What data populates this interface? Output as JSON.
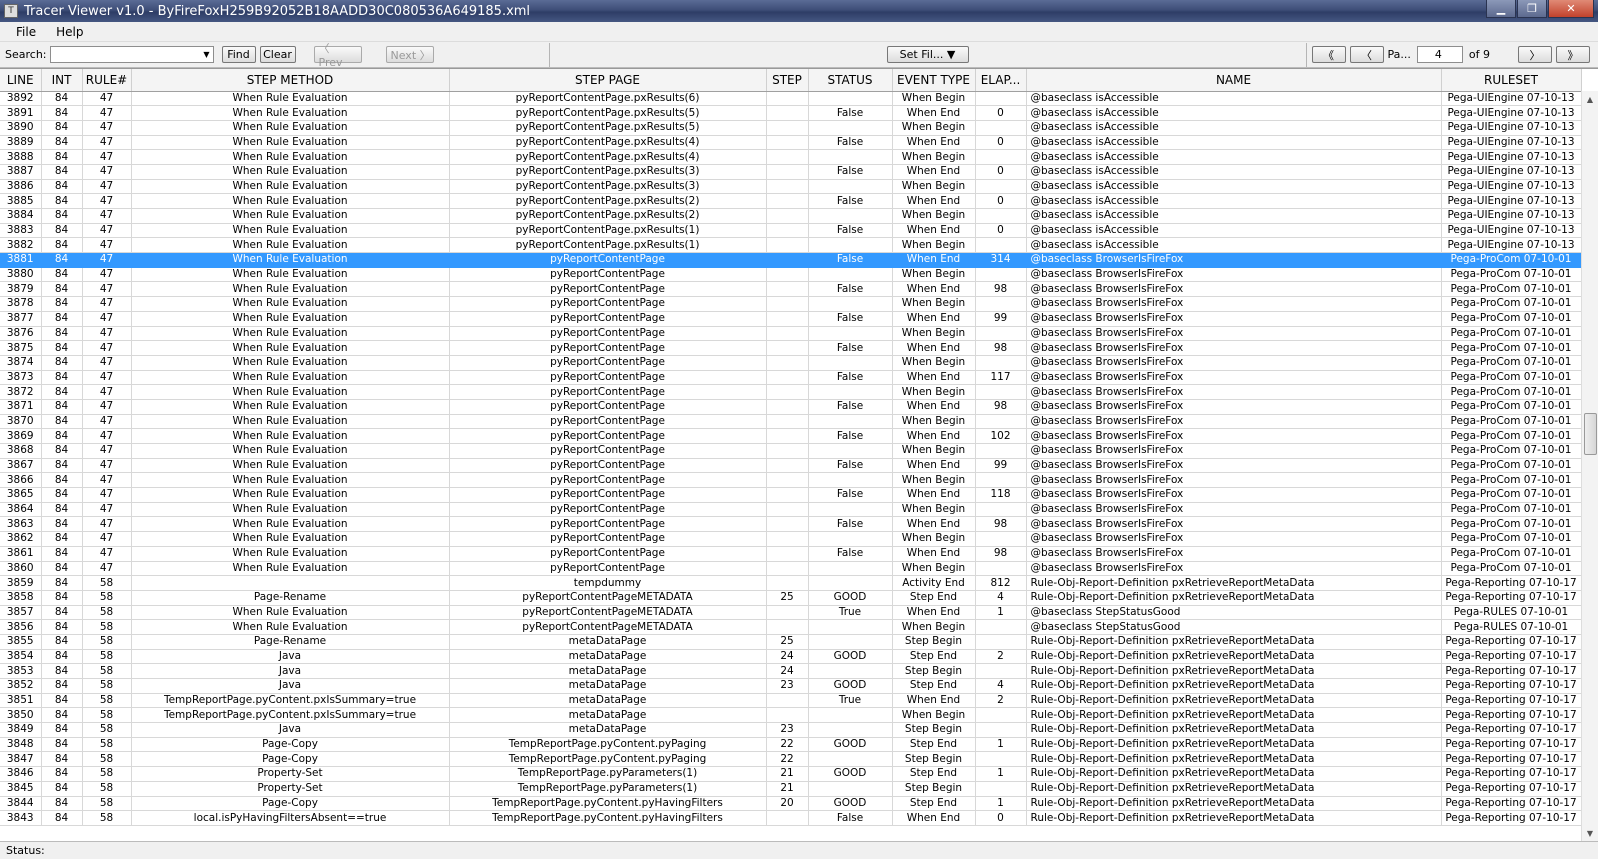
{
  "window": {
    "title": "Tracer Viewer v1.0 - ByFireFoxH259B92052B18AADD30C080536A649185.xml",
    "app_icon": "tracer-app-icon"
  },
  "menu": {
    "file": "File",
    "help": "Help"
  },
  "toolbar": {
    "search_label": "Search:",
    "search_value": "",
    "find": "Find",
    "clear": "Clear",
    "prev": "〈 Prev",
    "next": "Next 〉",
    "set_filter": "Set Fil... ▼",
    "first_page": "《",
    "prev_page": "〈",
    "page_label": "Pa...",
    "page_value": "4",
    "page_total": "of 9",
    "next_page": "〉",
    "last_page": "》"
  },
  "columns": [
    "LINE",
    "INT",
    "RULE#",
    "STEP METHOD",
    "STEP PAGE",
    "STEP",
    "STATUS",
    "EVENT TYPE",
    "ELAP...",
    "NAME",
    "RULESET"
  ],
  "selected_line": "3881",
  "rows": [
    [
      "3892",
      "84",
      "47",
      "When Rule Evaluation",
      "pyReportContentPage.pxResults(6)",
      "",
      "",
      "When Begin",
      "",
      "@baseclass isAccessible",
      "Pega-UIEngine 07-10-13"
    ],
    [
      "3891",
      "84",
      "47",
      "When Rule Evaluation",
      "pyReportContentPage.pxResults(5)",
      "",
      "False",
      "When End",
      "0",
      "@baseclass isAccessible",
      "Pega-UIEngine 07-10-13"
    ],
    [
      "3890",
      "84",
      "47",
      "When Rule Evaluation",
      "pyReportContentPage.pxResults(5)",
      "",
      "",
      "When Begin",
      "",
      "@baseclass isAccessible",
      "Pega-UIEngine 07-10-13"
    ],
    [
      "3889",
      "84",
      "47",
      "When Rule Evaluation",
      "pyReportContentPage.pxResults(4)",
      "",
      "False",
      "When End",
      "0",
      "@baseclass isAccessible",
      "Pega-UIEngine 07-10-13"
    ],
    [
      "3888",
      "84",
      "47",
      "When Rule Evaluation",
      "pyReportContentPage.pxResults(4)",
      "",
      "",
      "When Begin",
      "",
      "@baseclass isAccessible",
      "Pega-UIEngine 07-10-13"
    ],
    [
      "3887",
      "84",
      "47",
      "When Rule Evaluation",
      "pyReportContentPage.pxResults(3)",
      "",
      "False",
      "When End",
      "0",
      "@baseclass isAccessible",
      "Pega-UIEngine 07-10-13"
    ],
    [
      "3886",
      "84",
      "47",
      "When Rule Evaluation",
      "pyReportContentPage.pxResults(3)",
      "",
      "",
      "When Begin",
      "",
      "@baseclass isAccessible",
      "Pega-UIEngine 07-10-13"
    ],
    [
      "3885",
      "84",
      "47",
      "When Rule Evaluation",
      "pyReportContentPage.pxResults(2)",
      "",
      "False",
      "When End",
      "0",
      "@baseclass isAccessible",
      "Pega-UIEngine 07-10-13"
    ],
    [
      "3884",
      "84",
      "47",
      "When Rule Evaluation",
      "pyReportContentPage.pxResults(2)",
      "",
      "",
      "When Begin",
      "",
      "@baseclass isAccessible",
      "Pega-UIEngine 07-10-13"
    ],
    [
      "3883",
      "84",
      "47",
      "When Rule Evaluation",
      "pyReportContentPage.pxResults(1)",
      "",
      "False",
      "When End",
      "0",
      "@baseclass isAccessible",
      "Pega-UIEngine 07-10-13"
    ],
    [
      "3882",
      "84",
      "47",
      "When Rule Evaluation",
      "pyReportContentPage.pxResults(1)",
      "",
      "",
      "When Begin",
      "",
      "@baseclass isAccessible",
      "Pega-UIEngine 07-10-13"
    ],
    [
      "3881",
      "84",
      "47",
      "When Rule Evaluation",
      "pyReportContentPage",
      "",
      "False",
      "When End",
      "314",
      "@baseclass BrowserIsFireFox",
      "Pega-ProCom 07-10-01"
    ],
    [
      "3880",
      "84",
      "47",
      "When Rule Evaluation",
      "pyReportContentPage",
      "",
      "",
      "When Begin",
      "",
      "@baseclass BrowserIsFireFox",
      "Pega-ProCom 07-10-01"
    ],
    [
      "3879",
      "84",
      "47",
      "When Rule Evaluation",
      "pyReportContentPage",
      "",
      "False",
      "When End",
      "98",
      "@baseclass BrowserIsFireFox",
      "Pega-ProCom 07-10-01"
    ],
    [
      "3878",
      "84",
      "47",
      "When Rule Evaluation",
      "pyReportContentPage",
      "",
      "",
      "When Begin",
      "",
      "@baseclass BrowserIsFireFox",
      "Pega-ProCom 07-10-01"
    ],
    [
      "3877",
      "84",
      "47",
      "When Rule Evaluation",
      "pyReportContentPage",
      "",
      "False",
      "When End",
      "99",
      "@baseclass BrowserIsFireFox",
      "Pega-ProCom 07-10-01"
    ],
    [
      "3876",
      "84",
      "47",
      "When Rule Evaluation",
      "pyReportContentPage",
      "",
      "",
      "When Begin",
      "",
      "@baseclass BrowserIsFireFox",
      "Pega-ProCom 07-10-01"
    ],
    [
      "3875",
      "84",
      "47",
      "When Rule Evaluation",
      "pyReportContentPage",
      "",
      "False",
      "When End",
      "98",
      "@baseclass BrowserIsFireFox",
      "Pega-ProCom 07-10-01"
    ],
    [
      "3874",
      "84",
      "47",
      "When Rule Evaluation",
      "pyReportContentPage",
      "",
      "",
      "When Begin",
      "",
      "@baseclass BrowserIsFireFox",
      "Pega-ProCom 07-10-01"
    ],
    [
      "3873",
      "84",
      "47",
      "When Rule Evaluation",
      "pyReportContentPage",
      "",
      "False",
      "When End",
      "117",
      "@baseclass BrowserIsFireFox",
      "Pega-ProCom 07-10-01"
    ],
    [
      "3872",
      "84",
      "47",
      "When Rule Evaluation",
      "pyReportContentPage",
      "",
      "",
      "When Begin",
      "",
      "@baseclass BrowserIsFireFox",
      "Pega-ProCom 07-10-01"
    ],
    [
      "3871",
      "84",
      "47",
      "When Rule Evaluation",
      "pyReportContentPage",
      "",
      "False",
      "When End",
      "98",
      "@baseclass BrowserIsFireFox",
      "Pega-ProCom 07-10-01"
    ],
    [
      "3870",
      "84",
      "47",
      "When Rule Evaluation",
      "pyReportContentPage",
      "",
      "",
      "When Begin",
      "",
      "@baseclass BrowserIsFireFox",
      "Pega-ProCom 07-10-01"
    ],
    [
      "3869",
      "84",
      "47",
      "When Rule Evaluation",
      "pyReportContentPage",
      "",
      "False",
      "When End",
      "102",
      "@baseclass BrowserIsFireFox",
      "Pega-ProCom 07-10-01"
    ],
    [
      "3868",
      "84",
      "47",
      "When Rule Evaluation",
      "pyReportContentPage",
      "",
      "",
      "When Begin",
      "",
      "@baseclass BrowserIsFireFox",
      "Pega-ProCom 07-10-01"
    ],
    [
      "3867",
      "84",
      "47",
      "When Rule Evaluation",
      "pyReportContentPage",
      "",
      "False",
      "When End",
      "99",
      "@baseclass BrowserIsFireFox",
      "Pega-ProCom 07-10-01"
    ],
    [
      "3866",
      "84",
      "47",
      "When Rule Evaluation",
      "pyReportContentPage",
      "",
      "",
      "When Begin",
      "",
      "@baseclass BrowserIsFireFox",
      "Pega-ProCom 07-10-01"
    ],
    [
      "3865",
      "84",
      "47",
      "When Rule Evaluation",
      "pyReportContentPage",
      "",
      "False",
      "When End",
      "118",
      "@baseclass BrowserIsFireFox",
      "Pega-ProCom 07-10-01"
    ],
    [
      "3864",
      "84",
      "47",
      "When Rule Evaluation",
      "pyReportContentPage",
      "",
      "",
      "When Begin",
      "",
      "@baseclass BrowserIsFireFox",
      "Pega-ProCom 07-10-01"
    ],
    [
      "3863",
      "84",
      "47",
      "When Rule Evaluation",
      "pyReportContentPage",
      "",
      "False",
      "When End",
      "98",
      "@baseclass BrowserIsFireFox",
      "Pega-ProCom 07-10-01"
    ],
    [
      "3862",
      "84",
      "47",
      "When Rule Evaluation",
      "pyReportContentPage",
      "",
      "",
      "When Begin",
      "",
      "@baseclass BrowserIsFireFox",
      "Pega-ProCom 07-10-01"
    ],
    [
      "3861",
      "84",
      "47",
      "When Rule Evaluation",
      "pyReportContentPage",
      "",
      "False",
      "When End",
      "98",
      "@baseclass BrowserIsFireFox",
      "Pega-ProCom 07-10-01"
    ],
    [
      "3860",
      "84",
      "47",
      "When Rule Evaluation",
      "pyReportContentPage",
      "",
      "",
      "When Begin",
      "",
      "@baseclass BrowserIsFireFox",
      "Pega-ProCom 07-10-01"
    ],
    [
      "3859",
      "84",
      "58",
      "",
      "tempdummy",
      "",
      "",
      "Activity End",
      "812",
      "Rule-Obj-Report-Definition pxRetrieveReportMetaData",
      "Pega-Reporting 07-10-17"
    ],
    [
      "3858",
      "84",
      "58",
      "Page-Rename",
      "pyReportContentPageMETADATA",
      "25",
      "GOOD",
      "Step End",
      "4",
      "Rule-Obj-Report-Definition pxRetrieveReportMetaData",
      "Pega-Reporting 07-10-17"
    ],
    [
      "3857",
      "84",
      "58",
      "When Rule Evaluation",
      "pyReportContentPageMETADATA",
      "",
      "True",
      "When End",
      "1",
      "@baseclass StepStatusGood",
      "Pega-RULES 07-10-01"
    ],
    [
      "3856",
      "84",
      "58",
      "When Rule Evaluation",
      "pyReportContentPageMETADATA",
      "",
      "",
      "When Begin",
      "",
      "@baseclass StepStatusGood",
      "Pega-RULES 07-10-01"
    ],
    [
      "3855",
      "84",
      "58",
      "Page-Rename",
      "metaDataPage",
      "25",
      "",
      "Step Begin",
      "",
      "Rule-Obj-Report-Definition pxRetrieveReportMetaData",
      "Pega-Reporting 07-10-17"
    ],
    [
      "3854",
      "84",
      "58",
      "Java",
      "metaDataPage",
      "24",
      "GOOD",
      "Step End",
      "2",
      "Rule-Obj-Report-Definition pxRetrieveReportMetaData",
      "Pega-Reporting 07-10-17"
    ],
    [
      "3853",
      "84",
      "58",
      "Java",
      "metaDataPage",
      "24",
      "",
      "Step Begin",
      "",
      "Rule-Obj-Report-Definition pxRetrieveReportMetaData",
      "Pega-Reporting 07-10-17"
    ],
    [
      "3852",
      "84",
      "58",
      "Java",
      "metaDataPage",
      "23",
      "GOOD",
      "Step End",
      "4",
      "Rule-Obj-Report-Definition pxRetrieveReportMetaData",
      "Pega-Reporting 07-10-17"
    ],
    [
      "3851",
      "84",
      "58",
      "TempReportPage.pyContent.pxIsSummary=true",
      "metaDataPage",
      "",
      "True",
      "When End",
      "2",
      "Rule-Obj-Report-Definition pxRetrieveReportMetaData",
      "Pega-Reporting 07-10-17"
    ],
    [
      "3850",
      "84",
      "58",
      "TempReportPage.pyContent.pxIsSummary=true",
      "metaDataPage",
      "",
      "",
      "When Begin",
      "",
      "Rule-Obj-Report-Definition pxRetrieveReportMetaData",
      "Pega-Reporting 07-10-17"
    ],
    [
      "3849",
      "84",
      "58",
      "Java",
      "metaDataPage",
      "23",
      "",
      "Step Begin",
      "",
      "Rule-Obj-Report-Definition pxRetrieveReportMetaData",
      "Pega-Reporting 07-10-17"
    ],
    [
      "3848",
      "84",
      "58",
      "Page-Copy",
      "TempReportPage.pyContent.pyPaging",
      "22",
      "GOOD",
      "Step End",
      "1",
      "Rule-Obj-Report-Definition pxRetrieveReportMetaData",
      "Pega-Reporting 07-10-17"
    ],
    [
      "3847",
      "84",
      "58",
      "Page-Copy",
      "TempReportPage.pyContent.pyPaging",
      "22",
      "",
      "Step Begin",
      "",
      "Rule-Obj-Report-Definition pxRetrieveReportMetaData",
      "Pega-Reporting 07-10-17"
    ],
    [
      "3846",
      "84",
      "58",
      "Property-Set",
      "TempReportPage.pyParameters(1)",
      "21",
      "GOOD",
      "Step End",
      "1",
      "Rule-Obj-Report-Definition pxRetrieveReportMetaData",
      "Pega-Reporting 07-10-17"
    ],
    [
      "3845",
      "84",
      "58",
      "Property-Set",
      "TempReportPage.pyParameters(1)",
      "21",
      "",
      "Step Begin",
      "",
      "Rule-Obj-Report-Definition pxRetrieveReportMetaData",
      "Pega-Reporting 07-10-17"
    ],
    [
      "3844",
      "84",
      "58",
      "Page-Copy",
      "TempReportPage.pyContent.pyHavingFilters",
      "20",
      "GOOD",
      "Step End",
      "1",
      "Rule-Obj-Report-Definition pxRetrieveReportMetaData",
      "Pega-Reporting 07-10-17"
    ],
    [
      "3843",
      "84",
      "58",
      "local.isPyHavingFiltersAbsent==true",
      "TempReportPage.pyContent.pyHavingFilters",
      "",
      "False",
      "When End",
      "0",
      "Rule-Obj-Report-Definition pxRetrieveReportMetaData",
      "Pega-Reporting 07-10-17"
    ]
  ],
  "status": {
    "label": "Status:",
    "text": ""
  },
  "colors": {
    "selected_row": "#3399ff",
    "title_bar": "#3e4e78"
  }
}
